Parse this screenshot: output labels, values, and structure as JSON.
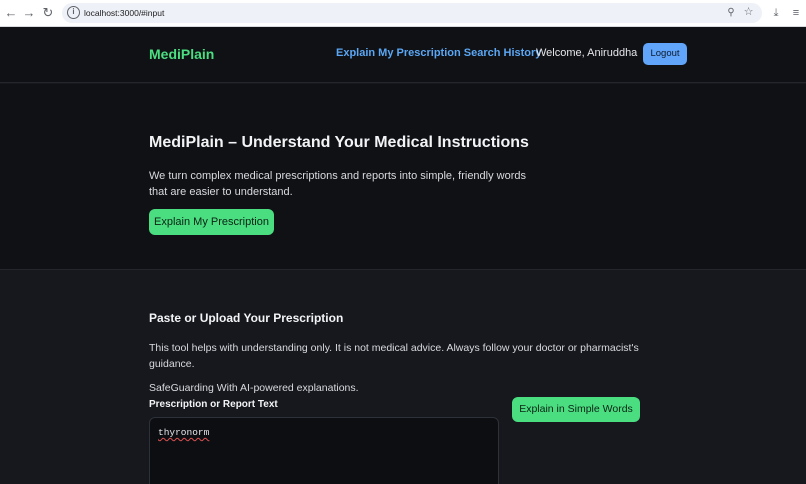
{
  "browser": {
    "url": "localhost:3000/#input",
    "icons": {
      "back": "back-arrow-icon",
      "forward": "forward-arrow-icon",
      "reload": "reload-icon",
      "info": "info-icon",
      "key": "key-icon",
      "star": "star-icon",
      "download": "download-icon",
      "menu": "menu-icon"
    }
  },
  "header": {
    "brand": "MediPlain",
    "nav_link": "Explain My Prescription Search History",
    "welcome": "Welcome, Aniruddha",
    "logout_label": "Logout"
  },
  "hero": {
    "title": "MediPlain – Understand Your Medical Instructions",
    "description": "We turn complex medical prescriptions and reports into simple, friendly words that are easier to understand.",
    "button_label": "Explain My Prescription"
  },
  "input_section": {
    "title": "Paste or Upload Your Prescription",
    "note": "This tool helps with understanding only. It is not medical advice. Always follow your doctor or pharmacist's guidance.",
    "safeguard": "SafeGuarding With AI-powered explanations.",
    "field_label": "Prescription or Report Text",
    "field_value": "thyronorm",
    "submit_label": "Explain in Simple Words"
  },
  "colors": {
    "accent_green": "#4ade80",
    "link_blue": "#5aa7f5",
    "logout_blue": "#60a5fa",
    "background": "#101115"
  }
}
